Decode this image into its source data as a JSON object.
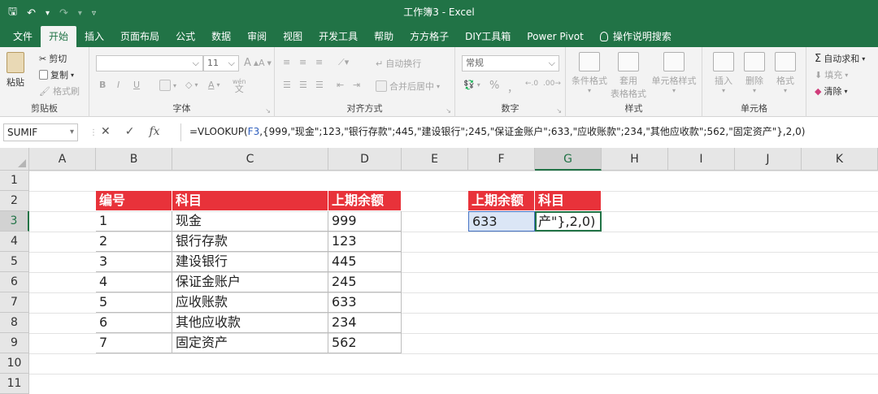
{
  "window": {
    "title": "工作簿3 - Excel"
  },
  "qat": {
    "save": "🖫",
    "undo": "↶",
    "undo_dd": "▾",
    "redo": "↷",
    "redo_dd": "▾",
    "customize": "▿"
  },
  "tabs": [
    "文件",
    "开始",
    "插入",
    "页面布局",
    "公式",
    "数据",
    "审阅",
    "视图",
    "开发工具",
    "帮助",
    "方方格子",
    "DIY工具箱",
    "Power Pivot"
  ],
  "search_label": "操作说明搜索",
  "ribbon": {
    "clipboard": {
      "paste": "粘贴",
      "cut": "剪切",
      "copy": "复制",
      "format_painter": "格式刷",
      "label": "剪贴板"
    },
    "font": {
      "size": "11",
      "bold": "B",
      "italic": "I",
      "underline": "U",
      "grow": "A",
      "shrink": "A",
      "wen": "wén",
      "label": "字体"
    },
    "alignment": {
      "wrap": "自动换行",
      "merge": "合并后居中",
      "label": "对齐方式"
    },
    "number": {
      "format": "常规",
      "percent": "%",
      "comma": "，",
      "label": "数字"
    },
    "styles": {
      "conditional": "条件格式",
      "table": "套用",
      "table2": "表格格式",
      "cell_styles": "单元格样式",
      "label": "样式"
    },
    "cells": {
      "insert": "插入",
      "delete": "删除",
      "format": "格式",
      "label": "单元格"
    },
    "editing": {
      "autosum": "自动求和",
      "fill": "填充",
      "clear": "清除"
    }
  },
  "formula_bar": {
    "name_box": "SUMIF",
    "cancel": "✕",
    "enter": "✓",
    "fx": "fx",
    "formula_prefix": "=VLOOKUP(",
    "formula_ref": "F3",
    "formula_rest": ",{999,\"现金\";123,\"银行存款\";445,\"建设银行\";245,\"保证金账户\";633,\"应收账款\";234,\"其他应收款\";562,\"固定资产\"},2,0)"
  },
  "columns": [
    "A",
    "B",
    "C",
    "D",
    "E",
    "F",
    "G",
    "H",
    "I",
    "J",
    "K"
  ],
  "rows": [
    "1",
    "2",
    "3",
    "4",
    "5",
    "6",
    "7",
    "8",
    "9",
    "10",
    "11"
  ],
  "table1": {
    "headers": [
      "编号",
      "科目",
      "上期余额"
    ],
    "rows": [
      [
        "1",
        "现金",
        "999"
      ],
      [
        "2",
        "银行存款",
        "123"
      ],
      [
        "3",
        "建设银行",
        "445"
      ],
      [
        "4",
        "保证金账户",
        "245"
      ],
      [
        "5",
        "应收账款",
        "633"
      ],
      [
        "6",
        "其他应收款",
        "234"
      ],
      [
        "7",
        "固定资产",
        "562"
      ]
    ]
  },
  "table2": {
    "headers": [
      "上期余额",
      "科目"
    ],
    "f3": "633",
    "g3": "产\"},2,0)"
  }
}
